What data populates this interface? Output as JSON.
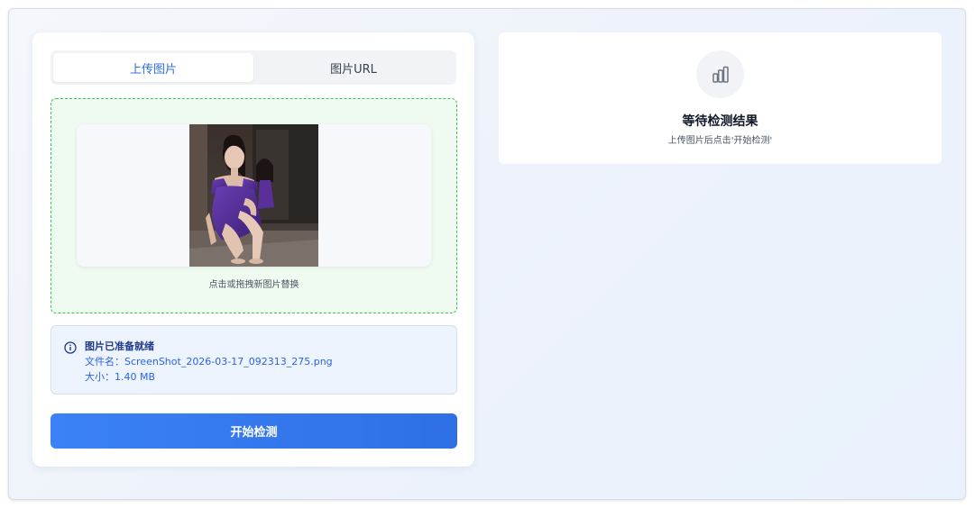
{
  "tabs": [
    {
      "label": "上传图片",
      "active": true
    },
    {
      "label": "图片URL",
      "active": false
    }
  ],
  "dropzone": {
    "hint": "点击或拖拽新图片替换",
    "preview_image": "photo-preview"
  },
  "file_info": {
    "icon": "info-icon",
    "title": "图片已准备就绪",
    "filename_line": "文件名：ScreenShot_2026-03-17_092313_275.png",
    "size_line": "大小：1.40 MB"
  },
  "start_button": {
    "label": "开始检测"
  },
  "result_panel": {
    "icon": "bar-chart-icon",
    "title": "等待检测结果",
    "subtitle": "上传图片后点击'开始检测'"
  },
  "colors": {
    "accent": "#2f6fe0",
    "dropzone_border": "#34c759",
    "dropzone_bg": "#effbf1",
    "info_bg": "#eef4fd",
    "button": "#3b82f6"
  }
}
